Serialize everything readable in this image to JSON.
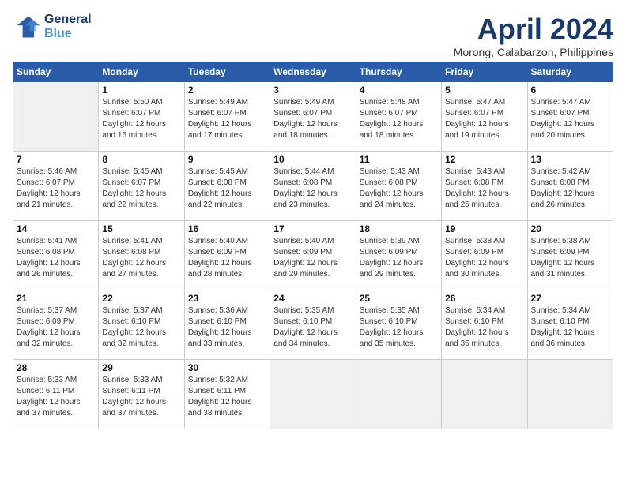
{
  "header": {
    "logo_line1": "General",
    "logo_line2": "Blue",
    "month": "April 2024",
    "location": "Morong, Calabarzon, Philippines"
  },
  "weekdays": [
    "Sunday",
    "Monday",
    "Tuesday",
    "Wednesday",
    "Thursday",
    "Friday",
    "Saturday"
  ],
  "weeks": [
    [
      {
        "day": "",
        "content": ""
      },
      {
        "day": "1",
        "content": "Sunrise: 5:50 AM\nSunset: 6:07 PM\nDaylight: 12 hours\nand 16 minutes."
      },
      {
        "day": "2",
        "content": "Sunrise: 5:49 AM\nSunset: 6:07 PM\nDaylight: 12 hours\nand 17 minutes."
      },
      {
        "day": "3",
        "content": "Sunrise: 5:49 AM\nSunset: 6:07 PM\nDaylight: 12 hours\nand 18 minutes."
      },
      {
        "day": "4",
        "content": "Sunrise: 5:48 AM\nSunset: 6:07 PM\nDaylight: 12 hours\nand 18 minutes."
      },
      {
        "day": "5",
        "content": "Sunrise: 5:47 AM\nSunset: 6:07 PM\nDaylight: 12 hours\nand 19 minutes."
      },
      {
        "day": "6",
        "content": "Sunrise: 5:47 AM\nSunset: 6:07 PM\nDaylight: 12 hours\nand 20 minutes."
      }
    ],
    [
      {
        "day": "7",
        "content": "Sunrise: 5:46 AM\nSunset: 6:07 PM\nDaylight: 12 hours\nand 21 minutes."
      },
      {
        "day": "8",
        "content": "Sunrise: 5:45 AM\nSunset: 6:07 PM\nDaylight: 12 hours\nand 22 minutes."
      },
      {
        "day": "9",
        "content": "Sunrise: 5:45 AM\nSunset: 6:08 PM\nDaylight: 12 hours\nand 22 minutes."
      },
      {
        "day": "10",
        "content": "Sunrise: 5:44 AM\nSunset: 6:08 PM\nDaylight: 12 hours\nand 23 minutes."
      },
      {
        "day": "11",
        "content": "Sunrise: 5:43 AM\nSunset: 6:08 PM\nDaylight: 12 hours\nand 24 minutes."
      },
      {
        "day": "12",
        "content": "Sunrise: 5:43 AM\nSunset: 6:08 PM\nDaylight: 12 hours\nand 25 minutes."
      },
      {
        "day": "13",
        "content": "Sunrise: 5:42 AM\nSunset: 6:08 PM\nDaylight: 12 hours\nand 26 minutes."
      }
    ],
    [
      {
        "day": "14",
        "content": "Sunrise: 5:41 AM\nSunset: 6:08 PM\nDaylight: 12 hours\nand 26 minutes."
      },
      {
        "day": "15",
        "content": "Sunrise: 5:41 AM\nSunset: 6:08 PM\nDaylight: 12 hours\nand 27 minutes."
      },
      {
        "day": "16",
        "content": "Sunrise: 5:40 AM\nSunset: 6:09 PM\nDaylight: 12 hours\nand 28 minutes."
      },
      {
        "day": "17",
        "content": "Sunrise: 5:40 AM\nSunset: 6:09 PM\nDaylight: 12 hours\nand 29 minutes."
      },
      {
        "day": "18",
        "content": "Sunrise: 5:39 AM\nSunset: 6:09 PM\nDaylight: 12 hours\nand 29 minutes."
      },
      {
        "day": "19",
        "content": "Sunrise: 5:38 AM\nSunset: 6:09 PM\nDaylight: 12 hours\nand 30 minutes."
      },
      {
        "day": "20",
        "content": "Sunrise: 5:38 AM\nSunset: 6:09 PM\nDaylight: 12 hours\nand 31 minutes."
      }
    ],
    [
      {
        "day": "21",
        "content": "Sunrise: 5:37 AM\nSunset: 6:09 PM\nDaylight: 12 hours\nand 32 minutes."
      },
      {
        "day": "22",
        "content": "Sunrise: 5:37 AM\nSunset: 6:10 PM\nDaylight: 12 hours\nand 32 minutes."
      },
      {
        "day": "23",
        "content": "Sunrise: 5:36 AM\nSunset: 6:10 PM\nDaylight: 12 hours\nand 33 minutes."
      },
      {
        "day": "24",
        "content": "Sunrise: 5:35 AM\nSunset: 6:10 PM\nDaylight: 12 hours\nand 34 minutes."
      },
      {
        "day": "25",
        "content": "Sunrise: 5:35 AM\nSunset: 6:10 PM\nDaylight: 12 hours\nand 35 minutes."
      },
      {
        "day": "26",
        "content": "Sunrise: 5:34 AM\nSunset: 6:10 PM\nDaylight: 12 hours\nand 35 minutes."
      },
      {
        "day": "27",
        "content": "Sunrise: 5:34 AM\nSunset: 6:10 PM\nDaylight: 12 hours\nand 36 minutes."
      }
    ],
    [
      {
        "day": "28",
        "content": "Sunrise: 5:33 AM\nSunset: 6:11 PM\nDaylight: 12 hours\nand 37 minutes."
      },
      {
        "day": "29",
        "content": "Sunrise: 5:33 AM\nSunset: 6:11 PM\nDaylight: 12 hours\nand 37 minutes."
      },
      {
        "day": "30",
        "content": "Sunrise: 5:32 AM\nSunset: 6:11 PM\nDaylight: 12 hours\nand 38 minutes."
      },
      {
        "day": "",
        "content": ""
      },
      {
        "day": "",
        "content": ""
      },
      {
        "day": "",
        "content": ""
      },
      {
        "day": "",
        "content": ""
      }
    ]
  ]
}
